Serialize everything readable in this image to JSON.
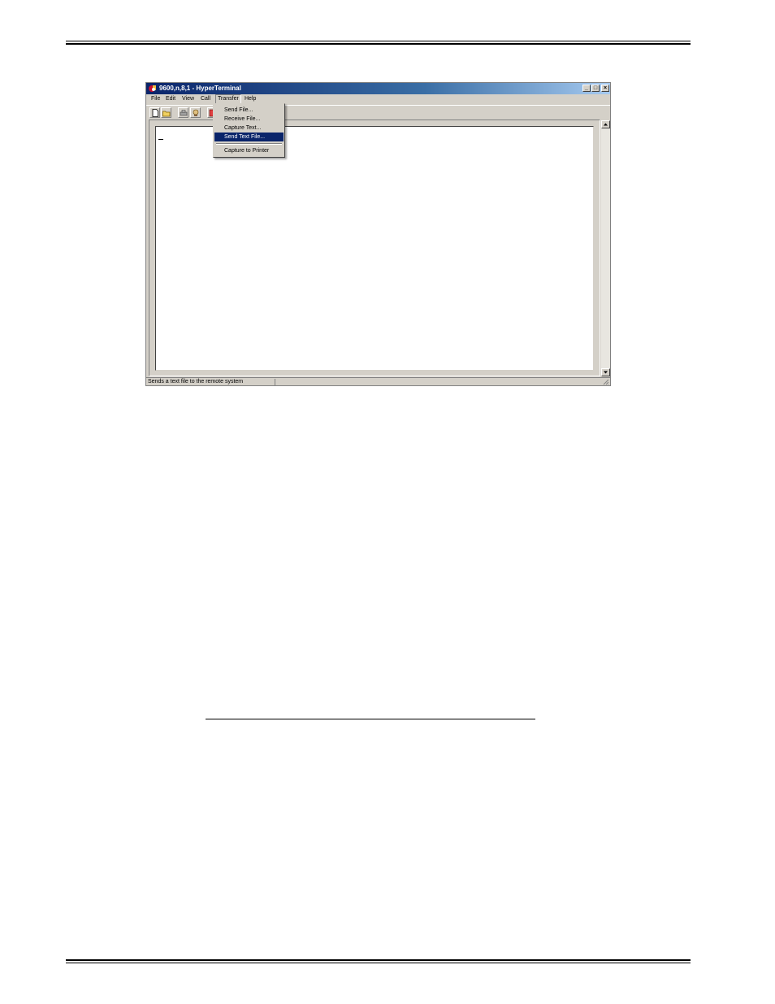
{
  "window": {
    "title": "9600,n,8,1 - HyperTerminal",
    "min_glyph": "_",
    "max_glyph": "□",
    "close_glyph": "×"
  },
  "menubar": {
    "items": [
      "File",
      "Edit",
      "View",
      "Call",
      "Transfer",
      "Help"
    ],
    "open_item": "Transfer"
  },
  "toolbar": {
    "buttons": [
      "new-icon",
      "open-icon",
      "disconnect-icon",
      "dial-icon",
      "send-icon"
    ]
  },
  "transfer_menu": {
    "items": [
      "Send File...",
      "Receive File...",
      "Capture Text...",
      "Send Text File...",
      "Capture to Printer"
    ],
    "selected": "Send Text File..."
  },
  "terminal": {
    "cursor": "_"
  },
  "statusbar": {
    "text": "Sends a text file to the remote system"
  }
}
